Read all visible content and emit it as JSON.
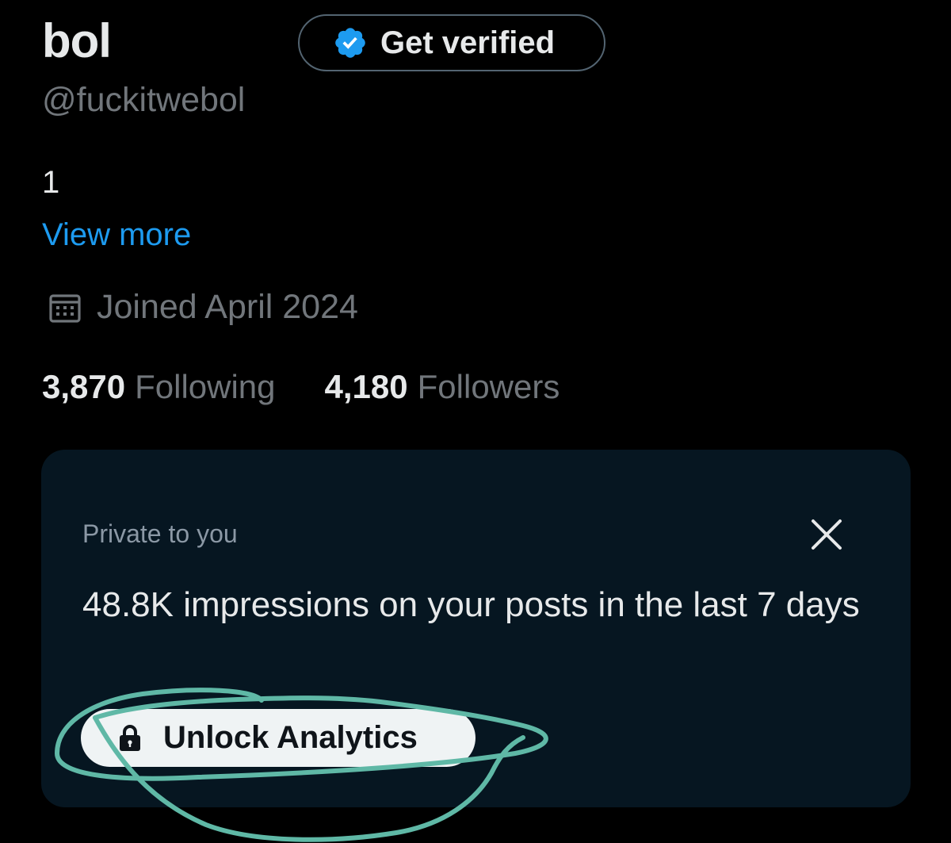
{
  "profile": {
    "display_name": "bol",
    "handle": "@fuckitwebol",
    "bio": "1",
    "view_more": "View more",
    "joined": "Joined April 2024"
  },
  "verify": {
    "label": "Get verified",
    "icon": "verified-badge-icon"
  },
  "stats": {
    "following_count": "3,870",
    "following_label": "Following",
    "followers_count": "4,180",
    "followers_label": "Followers"
  },
  "analytics_card": {
    "private_label": "Private to you",
    "impressions_text": "48.8K impressions on your posts in the last 7 days",
    "unlock_label": "Unlock Analytics",
    "close_icon": "close-icon",
    "lock_icon": "lock-icon"
  },
  "colors": {
    "background": "#000000",
    "card_background": "#061621",
    "link_blue": "#1d9bf0",
    "muted_text": "#71767b",
    "annotation": "#5fb8a6"
  }
}
